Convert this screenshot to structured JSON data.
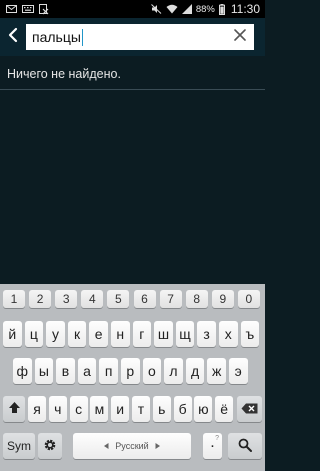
{
  "status_bar": {
    "battery_percent": "88%",
    "time": "11:30",
    "icons": [
      "email-icon",
      "keyboard-icon",
      "document-icon",
      "mute-icon",
      "wifi-icon",
      "signal-icon",
      "battery-icon"
    ]
  },
  "search": {
    "query": "пальцы",
    "back_icon": "chevron-left-icon",
    "clear_icon": "close-icon"
  },
  "results": {
    "empty_message": "Ничего не найдено."
  },
  "keyboard": {
    "number_row": [
      "1",
      "2",
      "3",
      "4",
      "5",
      "6",
      "7",
      "8",
      "9",
      "0"
    ],
    "row1": [
      "й",
      "ц",
      "у",
      "к",
      "е",
      "н",
      "г",
      "ш",
      "щ",
      "з",
      "х",
      "ъ"
    ],
    "row2": [
      "ф",
      "ы",
      "в",
      "а",
      "п",
      "р",
      "о",
      "л",
      "д",
      "ж",
      "э"
    ],
    "row3": [
      "я",
      "ч",
      "с",
      "м",
      "и",
      "т",
      "ь",
      "б",
      "ю",
      "ё"
    ],
    "sym_label": "Sym",
    "space_label": "Русский",
    "punct_label": ".",
    "punct_sub": "?",
    "colors": {
      "keyboard_bg": "#b9bcbf",
      "key_bg": "#fefefe",
      "accent": "#2196c8"
    }
  }
}
